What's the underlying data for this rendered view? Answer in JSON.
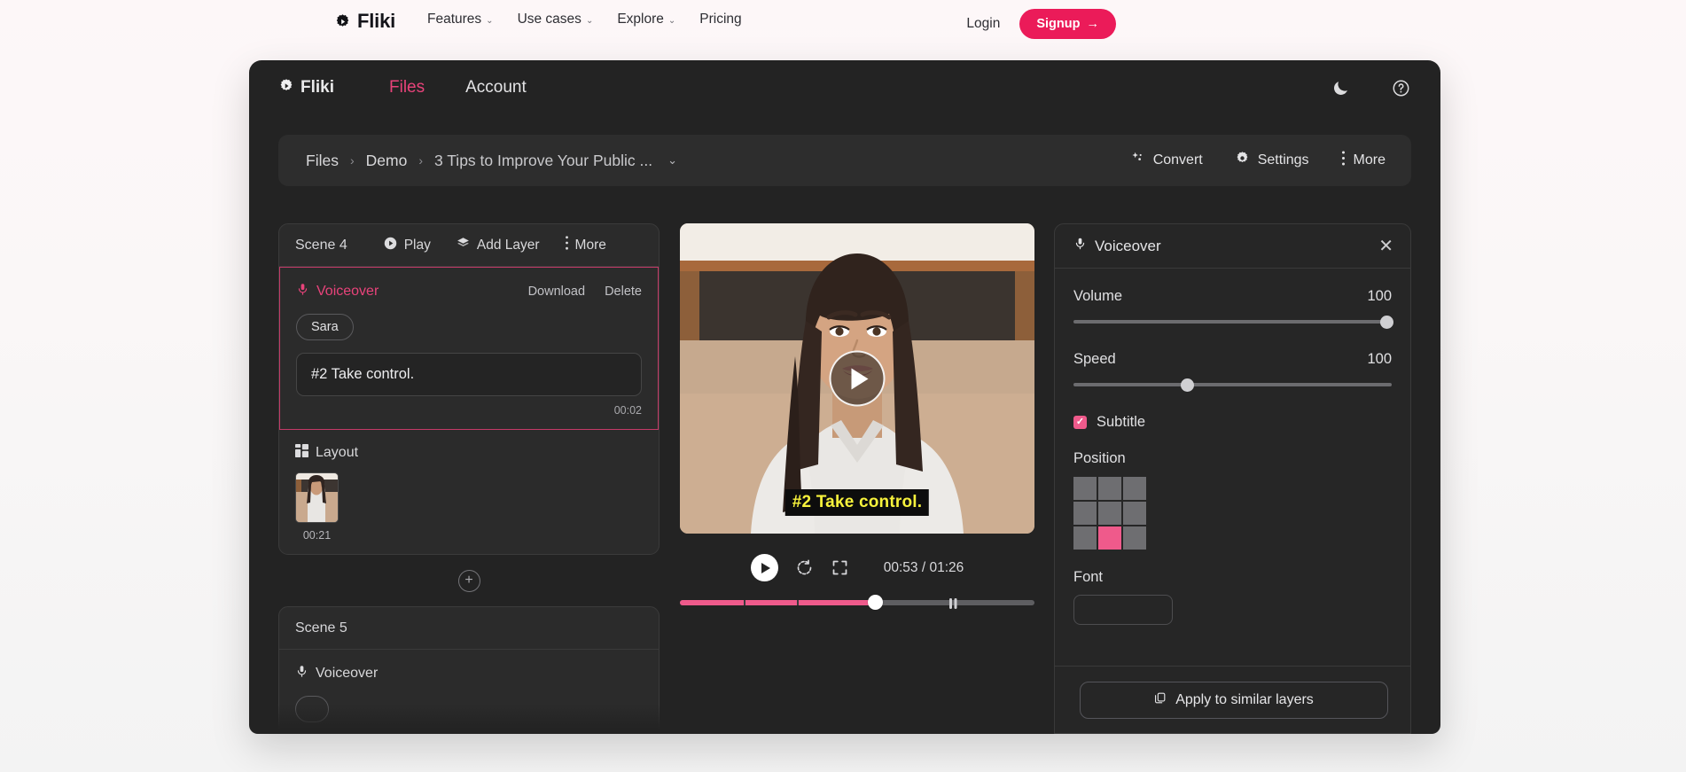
{
  "site_nav": {
    "brand": "Fliki",
    "brand_icon": "gear-play-icon",
    "links": [
      {
        "label": "Features",
        "caret": "⌄"
      },
      {
        "label": "Use cases",
        "caret": "⌄"
      },
      {
        "label": "Explore",
        "caret": "⌄"
      },
      {
        "label": "Pricing",
        "caret": ""
      }
    ],
    "login_label": "Login",
    "signup_label": "Signup",
    "signup_arrow": "→",
    "signup_color": "#eb1b59"
  },
  "app": {
    "brand": "Fliki",
    "tabs": [
      {
        "label": "Files",
        "active": true
      },
      {
        "label": "Account",
        "active": false
      }
    ],
    "active_tab_color": "#e8437a",
    "header_icons": [
      {
        "name": "dark-mode-moon-icon"
      },
      {
        "name": "help-circle-icon"
      }
    ],
    "breadcrumb": {
      "items": [
        "Files",
        "Demo",
        "3 Tips to Improve Your Public ..."
      ],
      "separator": "›",
      "caret": "⌄"
    },
    "breadcrumb_actions": [
      {
        "label": "Convert",
        "icon": "sparkles-icon"
      },
      {
        "label": "Settings",
        "icon": "gear-icon"
      },
      {
        "label": "More",
        "icon": "kebab-menu-icon"
      }
    ]
  },
  "left_panel": {
    "scenes": [
      {
        "title": "Scene 4",
        "actions": [
          {
            "label": "Play",
            "icon": "play-circle-icon"
          },
          {
            "label": "Add Layer",
            "icon": "layers-icon"
          },
          {
            "label": "More",
            "icon": "kebab-menu-icon"
          }
        ],
        "voiceover": {
          "label": "Voiceover",
          "icon": "microphone-icon",
          "download_label": "Download",
          "delete_label": "Delete",
          "voice_name": "Sara",
          "script": "#2 Take control.",
          "duration": "00:02",
          "selected": true
        },
        "layout": {
          "label": "Layout",
          "icon": "layout-grid-icon",
          "duration": "00:21"
        }
      },
      {
        "title": "Scene 5",
        "voiceover": {
          "label": "Voiceover",
          "icon": "microphone-icon"
        }
      }
    ],
    "add_scene_icon": "plus-circle-icon"
  },
  "player": {
    "subtitle_text": "#2 Take control.",
    "subtitle_color": "#f7f23c",
    "overlay_play_icon": "play-triangle-icon",
    "controls": [
      {
        "name": "play-button",
        "icon": "play-triangle-icon"
      },
      {
        "name": "restart-button",
        "icon": "rotate-ccw-icon"
      },
      {
        "name": "fullscreen-button",
        "icon": "expand-icon"
      }
    ],
    "current_time": "00:53",
    "total_time": "01:26",
    "time_display": "00:53 / 01:26",
    "progress_percent": 55,
    "progress_color": "#ef5a8b",
    "scene_markers_percent": [
      18,
      33
    ],
    "pause_marker_percent": 76
  },
  "right_panel": {
    "title": "Voiceover",
    "title_icon": "microphone-icon",
    "close_icon": "close-x-icon",
    "controls": [
      {
        "label": "Volume",
        "value": "100",
        "percent": 100
      },
      {
        "label": "Speed",
        "value": "100",
        "percent": 35
      }
    ],
    "subtitle": {
      "label": "Subtitle",
      "checked": true,
      "check_color": "#ef5a8b"
    },
    "position": {
      "label": "Position",
      "rows": 3,
      "cols": 3,
      "selected_index": 7,
      "selected_color": "#ef5a8b",
      "cell_color": "#6e6e71"
    },
    "font": {
      "label": "Font"
    },
    "apply_button": {
      "label": "Apply to similar layers",
      "icon": "copy-icon"
    }
  }
}
